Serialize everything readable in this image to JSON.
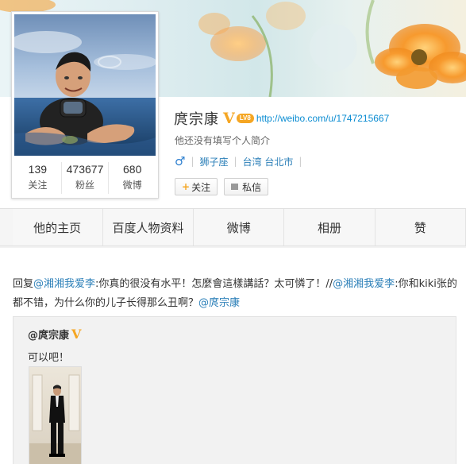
{
  "profile": {
    "name": "庹宗康",
    "verified_icon": "V",
    "level_badge": "LV8",
    "url": "http://weibo.com/u/1747215667",
    "bio": "他还没有填写个人简介",
    "gender_icon": "♂",
    "zodiac": "狮子座",
    "location": "台湾 台北市",
    "buttons": {
      "follow": "关注",
      "message": "私信"
    },
    "stats": [
      {
        "value": "139",
        "label": "关注"
      },
      {
        "value": "473677",
        "label": "粉丝"
      },
      {
        "value": "680",
        "label": "微博"
      }
    ]
  },
  "nav": {
    "tabs": [
      "他的主页",
      "百度人物资料",
      "微博",
      "相册",
      "赞"
    ]
  },
  "post": {
    "prefix": "回复",
    "mention1": "@湘湘我爱李",
    "text1": ":你真的很没有水平！怎麼會這樣講話？太可憐了！//",
    "mention2": "@湘湘我爱李",
    "text2": ":你和kiki张的都不错，为什么你的儿子长得那么丑啊？",
    "mention3": "@庹宗康"
  },
  "repost": {
    "author": "@庹宗康",
    "verified_icon": "V",
    "text": "可以吧！"
  },
  "colors": {
    "link": "#2b7fb8",
    "verified": "#f5a623",
    "url": "#0a8cd2"
  }
}
